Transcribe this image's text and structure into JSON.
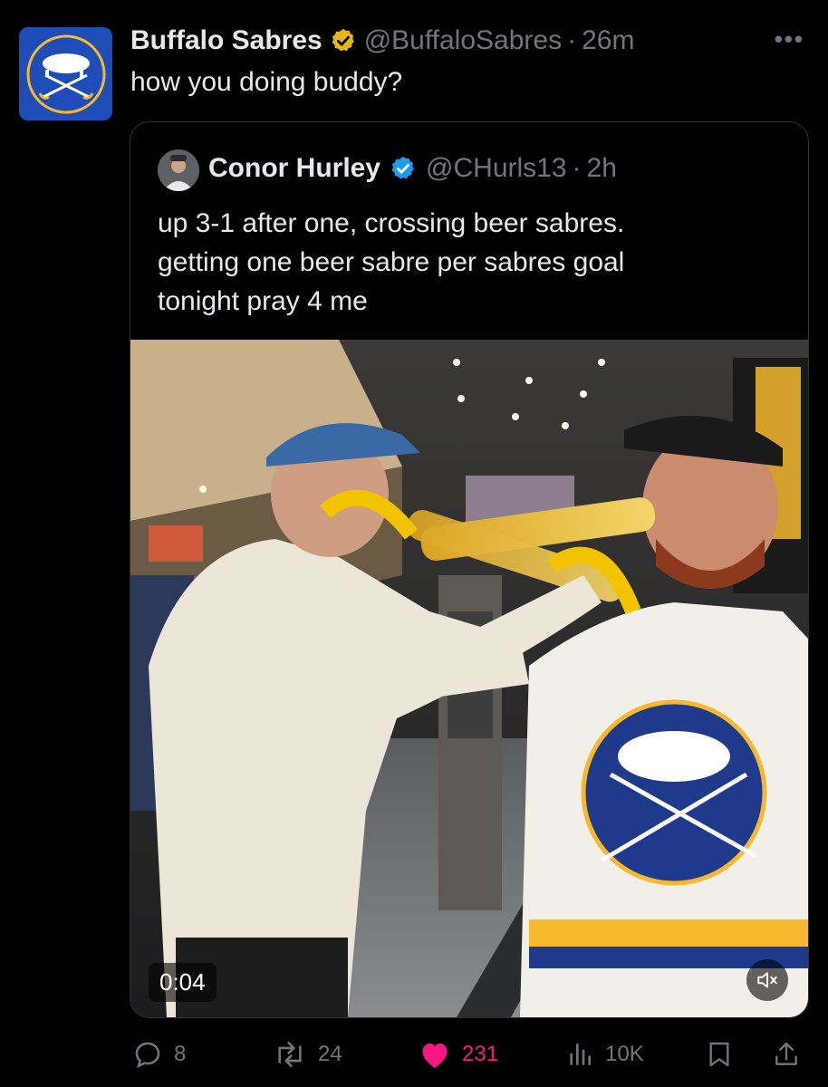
{
  "author": {
    "name": "Buffalo Sabres",
    "handle": "@BuffaloSabres",
    "separator": "·",
    "time": "26m",
    "avatar_icon": "sabres-logo-icon",
    "verified": "gold"
  },
  "tweet": {
    "text": "how you doing buddy?"
  },
  "quoted": {
    "name": "Conor Hurley",
    "handle": "@CHurls13",
    "separator": "·",
    "time": "2h",
    "verified": "blue",
    "lines": [
      "up 3-1 after one, crossing beer sabres.",
      "getting one beer sabre per sabres goal",
      "tonight pray 4 me"
    ],
    "video": {
      "duration": "0:04",
      "muted_icon": "volume-muted-icon"
    }
  },
  "metrics": {
    "replies": "8",
    "reposts": "24",
    "likes": "231",
    "views": "10K"
  },
  "colors": {
    "background": "#000000",
    "text": "#e7e9ea",
    "muted": "#71767b",
    "like": "#f91880",
    "verified_blue": "#1d9bf0",
    "verified_gold": "#e2b719",
    "sabres_blue": "#1f4db8"
  }
}
